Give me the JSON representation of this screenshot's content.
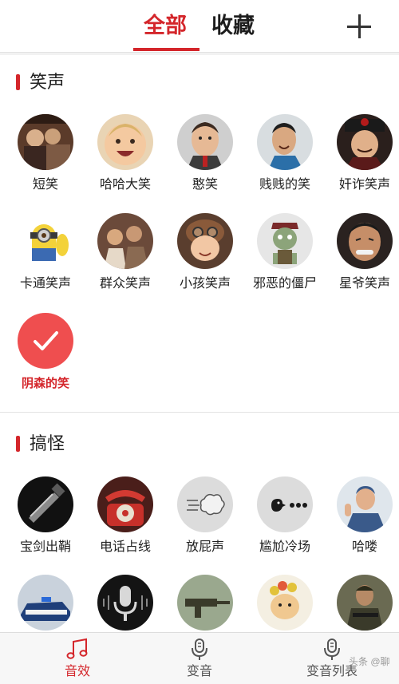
{
  "header": {
    "tabs": [
      {
        "label": "全部",
        "active": true
      },
      {
        "label": "收藏",
        "active": false
      }
    ],
    "add_icon": "plus-icon"
  },
  "sections": [
    {
      "title": "笑声",
      "items": [
        {
          "label": "短笑"
        },
        {
          "label": "哈哈大笑"
        },
        {
          "label": "憨笑"
        },
        {
          "label": "贱贱的笑"
        },
        {
          "label": "奸诈笑声"
        },
        {
          "label": "卡通笑声"
        },
        {
          "label": "群众笑声"
        },
        {
          "label": "小孩笑声"
        },
        {
          "label": "邪恶的僵尸"
        },
        {
          "label": "星爷笑声"
        },
        {
          "label": "阴森的笑",
          "selected": true,
          "icon": "checkmark-icon"
        }
      ]
    },
    {
      "title": "搞怪",
      "items": [
        {
          "label": "宝剑出鞘"
        },
        {
          "label": "电话占线"
        },
        {
          "label": "放屁声"
        },
        {
          "label": "尴尬冷场"
        },
        {
          "label": "哈喽"
        }
      ]
    }
  ],
  "bottom_nav": [
    {
      "label": "音效",
      "icon": "music-note-icon",
      "active": true
    },
    {
      "label": "变音",
      "icon": "microphone-icon",
      "active": false
    },
    {
      "label": "变音列表",
      "icon": "microphone-list-icon",
      "active": false
    }
  ],
  "watermark": "头条 @聊",
  "colors": {
    "accent": "#d4262b",
    "selected_circle": "#ef4e4f",
    "text": "#222222",
    "band": "#f2f2f2"
  }
}
